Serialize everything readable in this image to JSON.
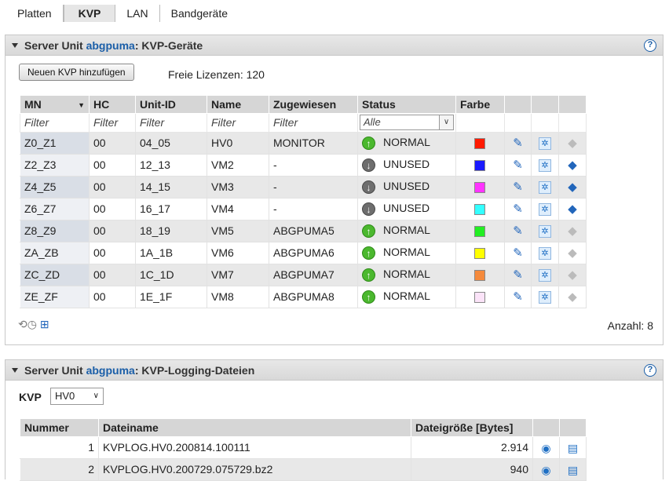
{
  "tabs": [
    {
      "label": "Platten",
      "active": false
    },
    {
      "label": "KVP",
      "active": true
    },
    {
      "label": "LAN",
      "active": false
    },
    {
      "label": "Bandgeräte",
      "active": false
    }
  ],
  "kvp_panel": {
    "prefix": "Server Unit ",
    "unit": "abgpuma",
    "suffix": ": KVP-Geräte",
    "help": "?",
    "add_button": "Neuen KVP hinzufügen",
    "licenses": "Freie Lizenzen: 120",
    "columns": [
      "MN",
      "HC",
      "Unit-ID",
      "Name",
      "Zugewiesen",
      "Status",
      "Farbe"
    ],
    "filter_placeholder": "Filter",
    "status_filter": "Alle",
    "rows": [
      {
        "mn": "Z0_Z1",
        "hc": "00",
        "unit": "04_05",
        "name": "HV0",
        "assigned": "MONITOR",
        "status": "NORMAL",
        "state": "normal",
        "color": "#ff1a00",
        "erase_enabled": false
      },
      {
        "mn": "Z2_Z3",
        "hc": "00",
        "unit": "12_13",
        "name": "VM2",
        "assigned": "-",
        "status": "UNUSED",
        "state": "unused",
        "color": "#1a1aff",
        "erase_enabled": true
      },
      {
        "mn": "Z4_Z5",
        "hc": "00",
        "unit": "14_15",
        "name": "VM3",
        "assigned": "-",
        "status": "UNUSED",
        "state": "unused",
        "color": "#ff33ff",
        "erase_enabled": true
      },
      {
        "mn": "Z6_Z7",
        "hc": "00",
        "unit": "16_17",
        "name": "VM4",
        "assigned": "-",
        "status": "UNUSED",
        "state": "unused",
        "color": "#33ffff",
        "erase_enabled": true
      },
      {
        "mn": "Z8_Z9",
        "hc": "00",
        "unit": "18_19",
        "name": "VM5",
        "assigned": "ABGPUMA5",
        "status": "NORMAL",
        "state": "normal",
        "color": "#22ee22",
        "erase_enabled": false
      },
      {
        "mn": "ZA_ZB",
        "hc": "00",
        "unit": "1A_1B",
        "name": "VM6",
        "assigned": "ABGPUMA6",
        "status": "NORMAL",
        "state": "normal",
        "color": "#ffff00",
        "erase_enabled": false
      },
      {
        "mn": "ZC_ZD",
        "hc": "00",
        "unit": "1C_1D",
        "name": "VM7",
        "assigned": "ABGPUMA7",
        "status": "NORMAL",
        "state": "normal",
        "color": "#f58a3c",
        "erase_enabled": false
      },
      {
        "mn": "ZE_ZF",
        "hc": "00",
        "unit": "1E_1F",
        "name": "VM8",
        "assigned": "ABGPUMA8",
        "status": "NORMAL",
        "state": "normal",
        "color": "#fbe3f8",
        "erase_enabled": false
      }
    ],
    "count": "Anzahl: 8"
  },
  "log_panel": {
    "prefix": "Server Unit ",
    "unit": "abgpuma",
    "suffix": ": KVP-Logging-Dateien",
    "help": "?",
    "kvp_label": "KVP",
    "kvp_value": "HV0",
    "columns": [
      "Nummer",
      "Dateiname",
      "Dateigröße [Bytes]"
    ],
    "rows": [
      {
        "num": "1",
        "file": "KVPLOG.HV0.200814.100111",
        "size": "2.914"
      },
      {
        "num": "2",
        "file": "KVPLOG.HV0.200729.075729.bz2",
        "size": "940"
      }
    ]
  },
  "colors": {
    "accent": "#1a5ea8",
    "header_bg": "#d6d6d6"
  },
  "icons": [
    "edit-icon",
    "configure-icon",
    "erase-icon",
    "refresh-icon",
    "export-icon",
    "view-icon",
    "download-icon",
    "help-icon"
  ]
}
